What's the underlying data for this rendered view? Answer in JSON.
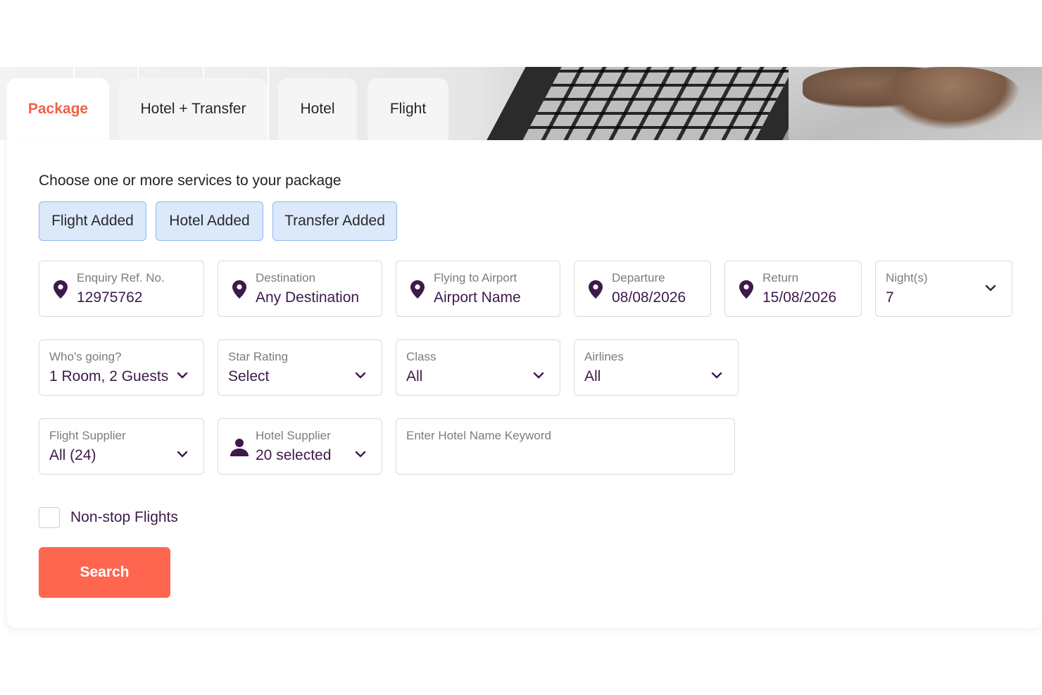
{
  "tabs": [
    {
      "label": "Package",
      "active": true
    },
    {
      "label": "Hotel + Transfer",
      "active": false
    },
    {
      "label": "Hotel",
      "active": false
    },
    {
      "label": "Flight",
      "active": false
    }
  ],
  "services": {
    "title": "Choose one or more services to your package",
    "chips": [
      {
        "label": "Flight Added"
      },
      {
        "label": "Hotel Added"
      },
      {
        "label": "Transfer Added"
      }
    ]
  },
  "fields": {
    "enquiry": {
      "label": "Enquiry Ref. No.",
      "value": "12975762",
      "icon": "location-pin-icon"
    },
    "destination": {
      "label": "Destination",
      "value": "Any Destination",
      "icon": "location-pin-icon"
    },
    "flying_to": {
      "label": "Flying to Airport",
      "value": "Airport Name",
      "icon": "location-pin-icon"
    },
    "departure": {
      "label": "Departure",
      "value": "08/08/2026",
      "icon": "location-pin-icon"
    },
    "return": {
      "label": "Return",
      "value": "15/08/2026",
      "icon": "location-pin-icon"
    },
    "nights": {
      "label": "Night(s)",
      "value": "7",
      "icon": "chevron-down-icon"
    },
    "whos_going": {
      "label": "Who's going?",
      "value": "1 Room, 2 Guests",
      "icon": "chevron-down-icon"
    },
    "star_rating": {
      "label": "Star Rating",
      "value": "Select",
      "icon": "chevron-down-icon"
    },
    "class": {
      "label": "Class",
      "value": "All",
      "icon": "chevron-down-icon"
    },
    "airlines": {
      "label": "Airlines",
      "value": "All",
      "icon": "chevron-down-icon"
    },
    "flight_supplier": {
      "label": "Flight Supplier",
      "value": "All (24)",
      "icon": "chevron-down-icon"
    },
    "hotel_supplier": {
      "label": "Hotel Supplier",
      "value": "20 selected",
      "icon": "person-icon"
    },
    "hotel_keyword": {
      "placeholder": "Enter Hotel Name Keyword",
      "value": ""
    }
  },
  "nonstop": {
    "label": "Non-stop Flights",
    "checked": false
  },
  "search": {
    "label": "Search"
  },
  "colors": {
    "accent": "#ff6650",
    "active_tab": "#f26146",
    "value_text": "#3d1a4a",
    "chip_bg": "#dbe9fb",
    "chip_border": "#8cb7ef"
  }
}
